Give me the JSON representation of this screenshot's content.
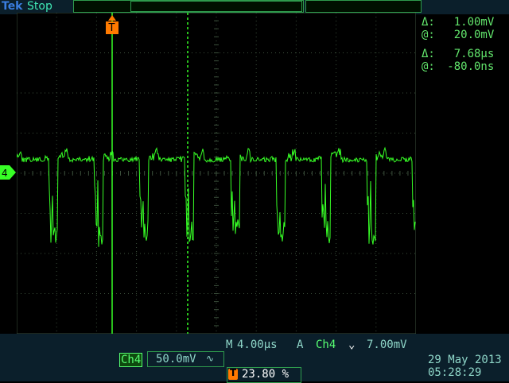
{
  "header": {
    "brand": "Tek",
    "status": "Stop"
  },
  "channel": {
    "marker": "4",
    "name": "Ch4",
    "scale": "50.0mV",
    "coupling_symbol": "∿"
  },
  "trigger": {
    "marker": "T",
    "source": "Ch4",
    "slope_symbol": "⌄",
    "level": "7.00mV",
    "mode": "A",
    "position_percent": "23.80 %"
  },
  "horizontal": {
    "label": "M",
    "timebase": "4.00µs"
  },
  "cursors": {
    "v_delta_label": "Δ:",
    "v_delta": "1.00mV",
    "v_at_label": "@:",
    "v_at": "20.0mV",
    "t_delta_label": "Δ:",
    "t_delta": "7.68µs",
    "t_at_label": "@:",
    "t_at": "-80.0ns"
  },
  "timestamp": {
    "date": "29 May 2013",
    "time": "05:28:29"
  },
  "colors": {
    "trace": "#37ff26",
    "grid": "#3b4f3b",
    "accent": "#ff7a00"
  }
}
